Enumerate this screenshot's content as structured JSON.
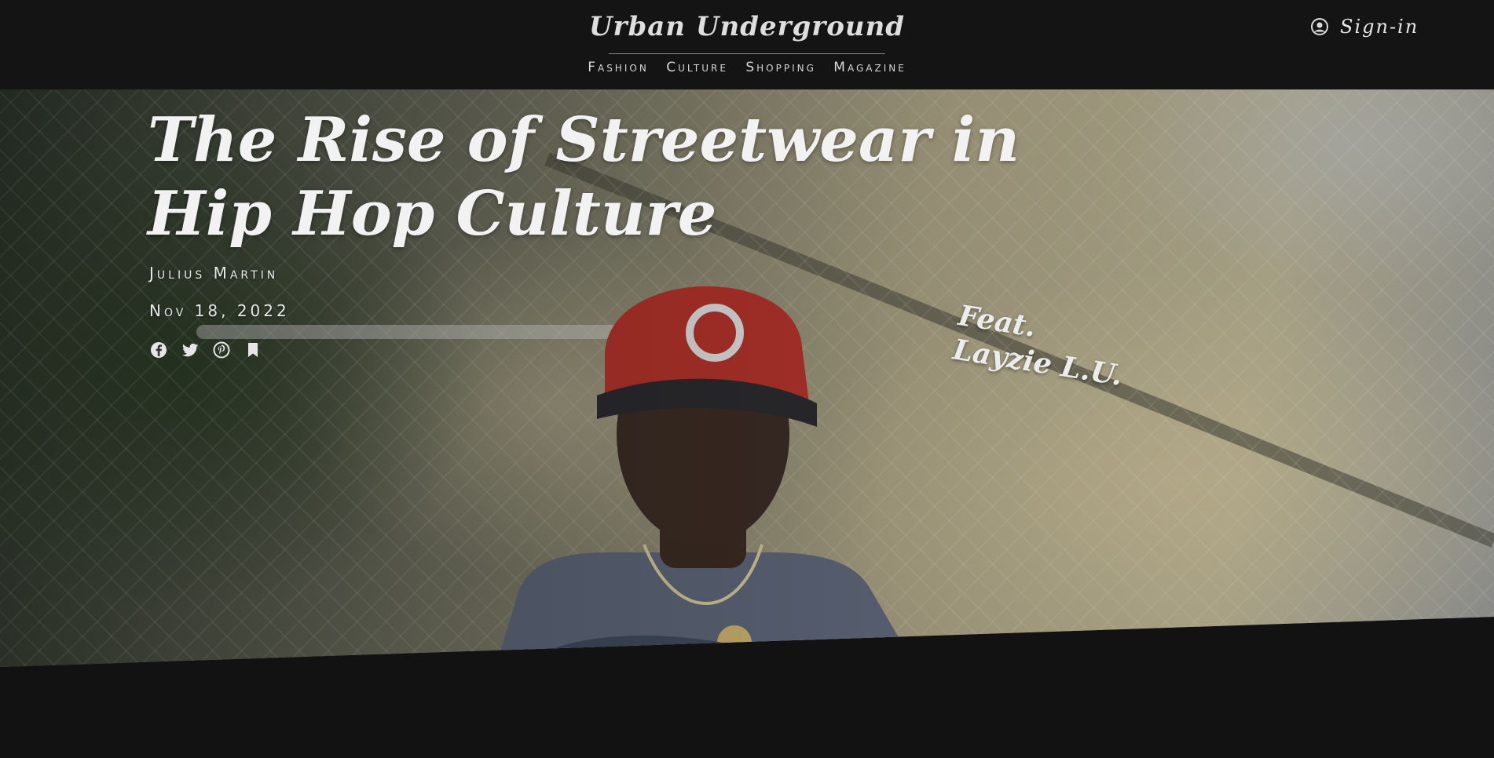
{
  "brand": {
    "name": "Urban Underground"
  },
  "nav": {
    "items": [
      {
        "label": "Fashion"
      },
      {
        "label": "Culture"
      },
      {
        "label": "Shopping"
      },
      {
        "label": "Magazine"
      }
    ]
  },
  "account": {
    "signin_label": "Sign-in",
    "icon": "user-circle-icon"
  },
  "article": {
    "title": "The Rise of Streetwear in Hip Hop Culture",
    "author": "Julius Martin",
    "date": "Nov 18, 2022",
    "feature_line1": "Feat.",
    "feature_line2": "Layzie L.U.",
    "share_icons": [
      "facebook-icon",
      "twitter-icon",
      "pinterest-icon",
      "bookmark-icon"
    ]
  },
  "colors": {
    "background": "#121212",
    "text": "#e6e6e6",
    "cap_red": "#b3322a"
  }
}
